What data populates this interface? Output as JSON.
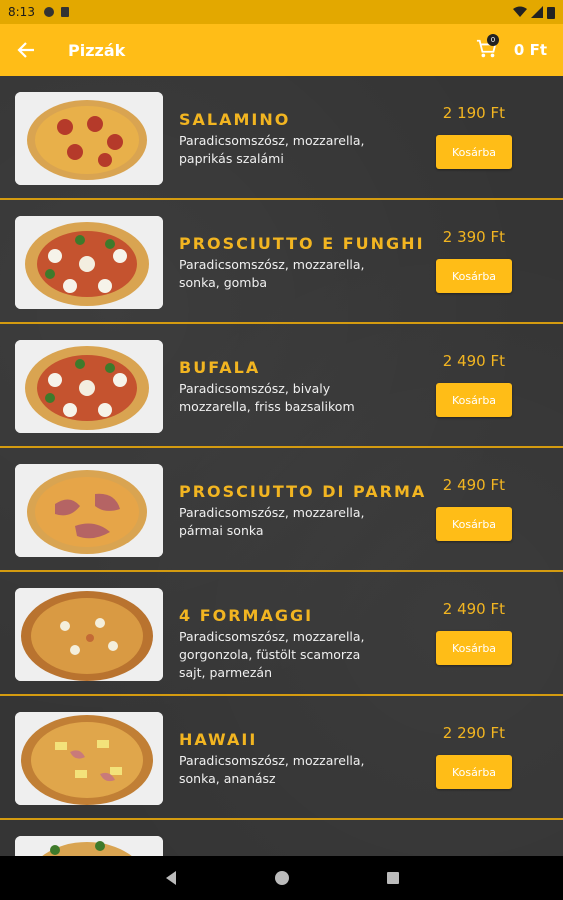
{
  "status": {
    "time": "8:13"
  },
  "header": {
    "title": "Pizzák",
    "cart_count": "0",
    "cart_total": "0 Ft"
  },
  "add_label": "Kosárba",
  "products": [
    {
      "name": "SALAMINO",
      "desc": "Paradicsomszósz, mozzarella, paprikás szalámi",
      "price": "2 190 Ft"
    },
    {
      "name": "PROSCIUTTO E FUNGHI",
      "desc": "Paradicsomszósz, mozzarella, sonka, gomba",
      "price": "2 390 Ft"
    },
    {
      "name": "BUFALA",
      "desc": "Paradicsomszósz, bivaly mozzarella, friss bazsalikom",
      "price": "2 490 Ft"
    },
    {
      "name": "PROSCIUTTO DI PARMA",
      "desc": "Paradicsomszósz, mozzarella, pármai sonka",
      "price": "2 490 Ft"
    },
    {
      "name": "4 FORMAGGI",
      "desc": "Paradicsomszósz, mozzarella, gorgonzola, füstölt scamorza sajt, parmezán",
      "price": "2 490 Ft"
    },
    {
      "name": "HAWAII",
      "desc": "Paradicsomszósz, mozzarella, sonka, ananász",
      "price": "2 290 Ft"
    }
  ],
  "colors": {
    "accent": "#ffbd17",
    "name_text": "#f2b521",
    "background": "#353535"
  },
  "icons": [
    "back-arrow-icon",
    "cart-icon",
    "nav-back-icon",
    "nav-home-icon",
    "nav-recents-icon"
  ]
}
